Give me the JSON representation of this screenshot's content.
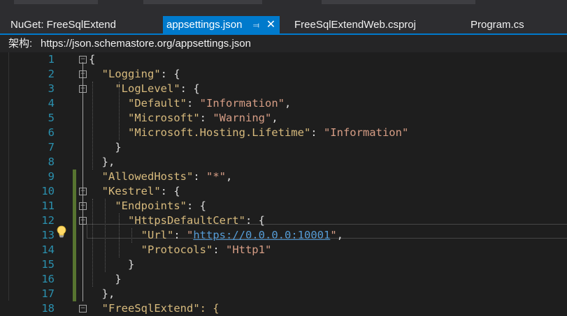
{
  "tabs": [
    {
      "label": "NuGet: FreeSqlExtend",
      "active": false
    },
    {
      "label": "appsettings.json",
      "active": true
    },
    {
      "label": "FreeSqlExtendWeb.csproj",
      "active": false
    },
    {
      "label": "Program.cs",
      "active": false
    }
  ],
  "active_tab": {
    "pin_icon": "pin-icon",
    "close_icon": "close-icon"
  },
  "schema": {
    "label": "架构:",
    "url": "https://json.schemastore.org/appsettings.json"
  },
  "editor": {
    "current_line": 13,
    "lines": [
      {
        "n": "1"
      },
      {
        "n": "2"
      },
      {
        "n": "3"
      },
      {
        "n": "4"
      },
      {
        "n": "5"
      },
      {
        "n": "6"
      },
      {
        "n": "7"
      },
      {
        "n": "8"
      },
      {
        "n": "9"
      },
      {
        "n": "10"
      },
      {
        "n": "11"
      },
      {
        "n": "12"
      },
      {
        "n": "13"
      },
      {
        "n": "14"
      },
      {
        "n": "15"
      },
      {
        "n": "16"
      },
      {
        "n": "17"
      },
      {
        "n": "18"
      }
    ],
    "text": {
      "open": "{",
      "logging": "\"Logging\"",
      "loglevel": "\"LogLevel\"",
      "default_k": "\"Default\"",
      "default_v": "\"Information\"",
      "microsoft_k": "\"Microsoft\"",
      "microsoft_v": "\"Warning\"",
      "hosting_k": "\"Microsoft.Hosting.Lifetime\"",
      "hosting_v": "\"Information\"",
      "allowed_k": "\"AllowedHosts\"",
      "allowed_v": "\"*\"",
      "kestrel": "\"Kestrel\"",
      "endpoints": "\"Endpoints\"",
      "https": "\"HttpsDefaultCert\"",
      "url_k": "\"Url\"",
      "url_q": "\"",
      "url_v": "https://0.0.0.0:10001",
      "protocols_k": "\"Protocols\"",
      "protocols_v": "\"Http1\"",
      "line18": "\"FreeSqlExtend\": {"
    }
  }
}
